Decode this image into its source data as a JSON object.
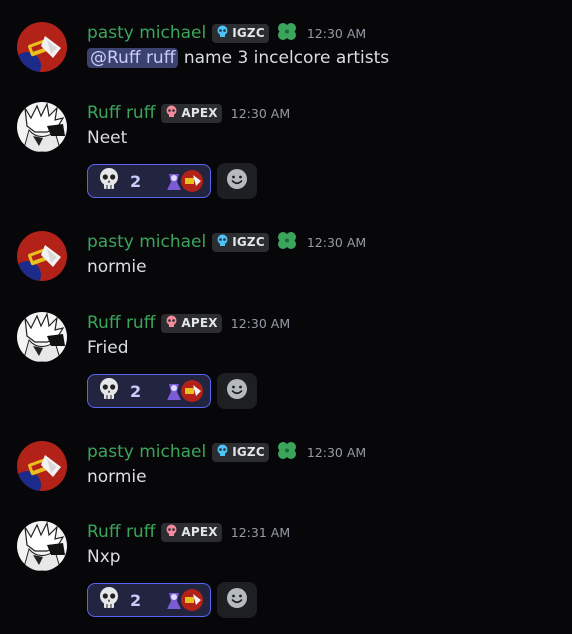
{
  "messages": [
    {
      "username": "pasty michael",
      "tag": "IGZC",
      "timestamp": "12:30 AM",
      "mention": "@Ruff ruff",
      "text": "name 3 incelcore artists"
    },
    {
      "username": "Ruff ruff",
      "tag": "APEX",
      "timestamp": "12:30 AM",
      "text": "Neet",
      "reaction": {
        "emoji": "skull-emoji",
        "count": "2"
      }
    },
    {
      "username": "pasty michael",
      "tag": "IGZC",
      "timestamp": "12:30 AM",
      "text": "normie"
    },
    {
      "username": "Ruff ruff",
      "tag": "APEX",
      "timestamp": "12:30 AM",
      "text": "Fried",
      "reaction": {
        "emoji": "skull-emoji",
        "count": "2"
      }
    },
    {
      "username": "pasty michael",
      "tag": "IGZC",
      "timestamp": "12:30 AM",
      "text": "normie"
    },
    {
      "username": "Ruff ruff",
      "tag": "APEX",
      "timestamp": "12:31 AM",
      "text": "Nxp",
      "reaction": {
        "emoji": "skull-emoji",
        "count": "2"
      }
    }
  ],
  "colors": {
    "background": "#070709",
    "username": "#3ba55c",
    "timestamp": "#949ba4",
    "mention_bg": "#3c4270",
    "reaction_border": "#5865f2"
  }
}
